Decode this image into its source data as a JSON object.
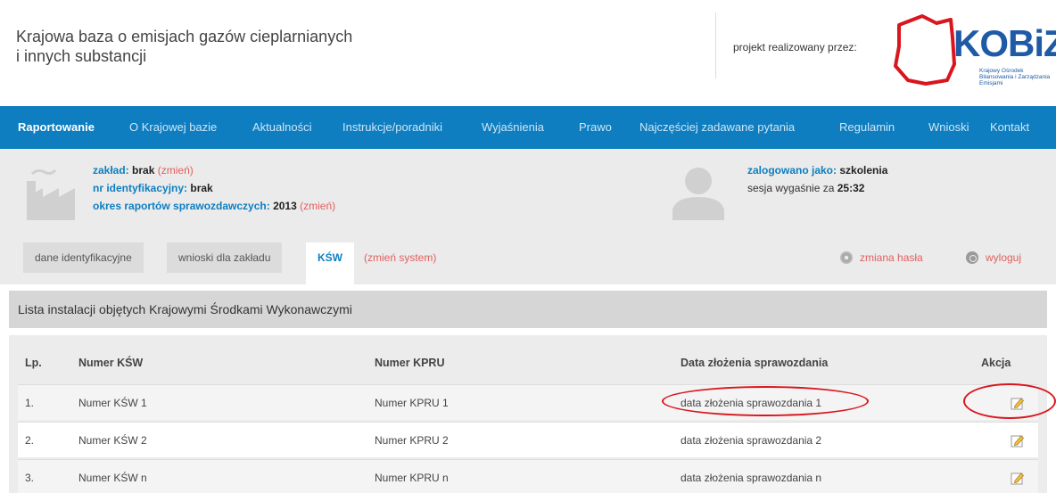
{
  "header": {
    "title_line1": "Krajowa baza o emisjach gazów cieplarnianych",
    "title_line2": "i innych substancji",
    "project_label": "projekt realizowany przez:",
    "logo_text": "KOBiZE",
    "logo_subtext": "Krajowy Ośrodek Bilansowania i Zarządzania Emisjami",
    "brand_color": "#1e5aa6"
  },
  "nav": {
    "color": "#0e7ec0",
    "items": [
      {
        "label": "Raportowanie"
      },
      {
        "label": "O Krajowej bazie"
      },
      {
        "label": "Aktualności"
      },
      {
        "label": "Instrukcje/poradniki"
      },
      {
        "label": "Wyjaśnienia"
      },
      {
        "label": "Prawo"
      },
      {
        "label": "Najczęściej zadawane pytania"
      },
      {
        "label": "Regulamin"
      },
      {
        "label": "Wnioski"
      },
      {
        "label": "Kontakt"
      }
    ]
  },
  "info": {
    "zaklad_label": "zakład:",
    "zaklad_value": "brak",
    "nr_label": "nr identyfikacyjny:",
    "nr_value": "brak",
    "okres_label": "okres raportów sprawozdawczych:",
    "okres_value": "2013",
    "change_link": "(zmień)",
    "user_label": "zalogowano jako:",
    "user_value": "szkolenia",
    "session_label": "sesja wygaśnie za",
    "session_value": "25:32"
  },
  "tabs": {
    "items": [
      {
        "label": "dane identyfikacyjne"
      },
      {
        "label": "wnioski dla zakładu"
      },
      {
        "label": "KŚW"
      }
    ],
    "change_system": "(zmień system)",
    "change_password": "zmiana hasła",
    "logout": "wyloguj"
  },
  "list": {
    "title": "Lista instalacji objętych Krajowymi Środkami Wykonawczymi",
    "columns": [
      "Lp.",
      "Numer KŚW",
      "Numer KPRU",
      "Data złożenia sprawozdania",
      "Akcja"
    ],
    "rows": [
      {
        "lp": "1.",
        "ksw": "Numer KŚW 1",
        "kpru": "Numer KPRU 1",
        "data": "data złożenia sprawozdania 1"
      },
      {
        "lp": "2.",
        "ksw": "Numer KŚW 2",
        "kpru": "Numer KPRU 2",
        "data": "data złożenia sprawozdania 2"
      },
      {
        "lp": "3.",
        "ksw": "Numer KŚW n",
        "kpru": "Numer KPRU n",
        "data": "data złożenia sprawozdania n"
      }
    ],
    "annotation_color": "#d9151e"
  }
}
